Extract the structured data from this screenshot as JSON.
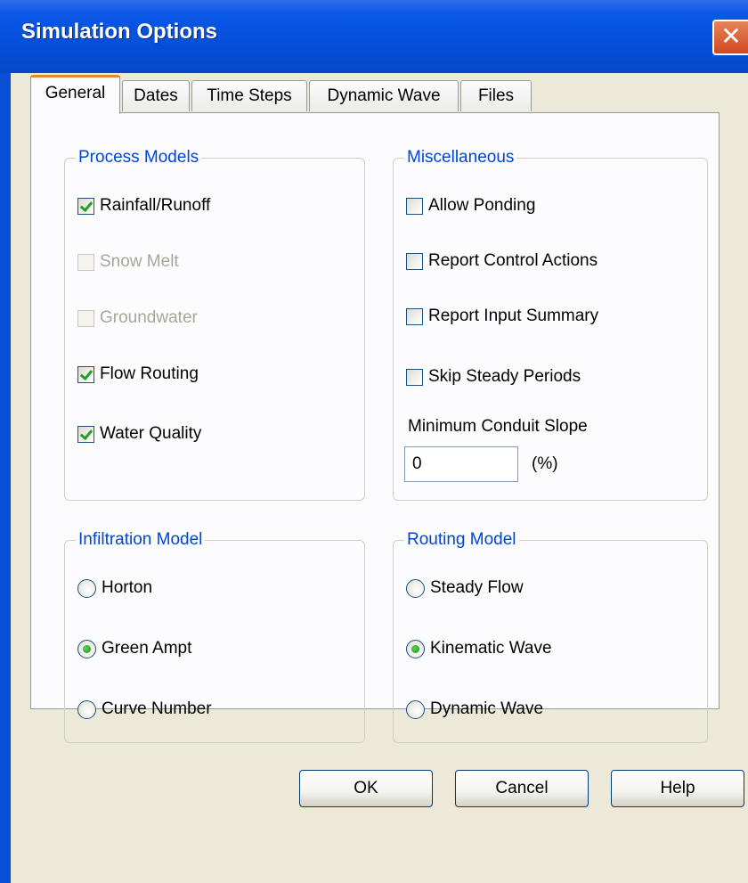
{
  "window": {
    "title": "Simulation Options",
    "close_glyph": "✕"
  },
  "tabs": [
    {
      "label": "General",
      "active": true
    },
    {
      "label": "Dates",
      "active": false
    },
    {
      "label": "Time Steps",
      "active": false
    },
    {
      "label": "Dynamic Wave",
      "active": false
    },
    {
      "label": "Files",
      "active": false
    }
  ],
  "process_models": {
    "title": "Process Models",
    "items": [
      {
        "label": "Rainfall/Runoff",
        "checked": true,
        "enabled": true
      },
      {
        "label": "Snow Melt",
        "checked": false,
        "enabled": false
      },
      {
        "label": "Groundwater",
        "checked": false,
        "enabled": false
      },
      {
        "label": "Flow Routing",
        "checked": true,
        "enabled": true
      },
      {
        "label": "Water Quality",
        "checked": true,
        "enabled": true
      }
    ]
  },
  "miscellaneous": {
    "title": "Miscellaneous",
    "items": [
      {
        "label": "Allow Ponding",
        "checked": false
      },
      {
        "label": "Report Control Actions",
        "checked": false
      },
      {
        "label": "Report Input Summary",
        "checked": false
      },
      {
        "label": "Skip Steady Periods",
        "checked": false
      }
    ],
    "min_slope_label": "Minimum Conduit Slope",
    "min_slope_value": "0",
    "min_slope_unit": "(%)"
  },
  "infiltration_model": {
    "title": "Infiltration Model",
    "options": [
      {
        "label": "Horton",
        "selected": false
      },
      {
        "label": "Green Ampt",
        "selected": true
      },
      {
        "label": "Curve Number",
        "selected": false
      }
    ]
  },
  "routing_model": {
    "title": "Routing Model",
    "options": [
      {
        "label": "Steady Flow",
        "selected": false
      },
      {
        "label": "Kinematic Wave",
        "selected": true
      },
      {
        "label": "Dynamic Wave",
        "selected": false
      }
    ]
  },
  "buttons": {
    "ok": "OK",
    "cancel": "Cancel",
    "help": "Help"
  }
}
